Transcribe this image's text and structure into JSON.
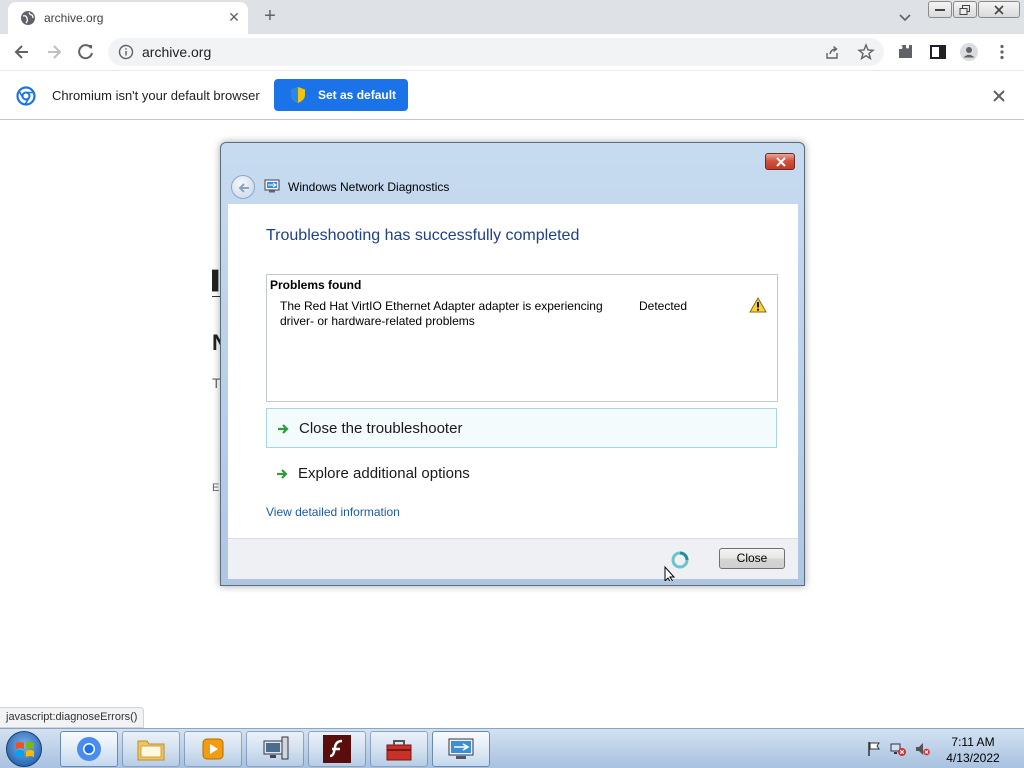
{
  "browser": {
    "tab_title": "archive.org",
    "url": "archive.org",
    "infobar_text": "Chromium isn't your default browser",
    "set_default_label": "Set as default"
  },
  "page_behind": {
    "fragments": [
      "▌",
      "N",
      "T",
      "E"
    ]
  },
  "dialog": {
    "title": "Windows Network Diagnostics",
    "heading": "Troubleshooting has successfully completed",
    "problems_title": "Problems found",
    "problem": {
      "description": "The Red Hat VirtIO Ethernet Adapter adapter is experiencing driver- or hardware-related problems",
      "status": "Detected"
    },
    "options": [
      {
        "label": "Close the troubleshooter"
      },
      {
        "label": "Explore additional options"
      }
    ],
    "view_details": "View detailed information",
    "close_label": "Close"
  },
  "status_bar": {
    "url": "javascript:diagnoseErrors()"
  },
  "taskbar": {
    "time": "7:11 AM",
    "date": "4/13/2022"
  },
  "colors": {
    "accent_blue": "#1a73e8",
    "dialog_heading": "#1e3f8a",
    "link": "#1c5aa8"
  }
}
